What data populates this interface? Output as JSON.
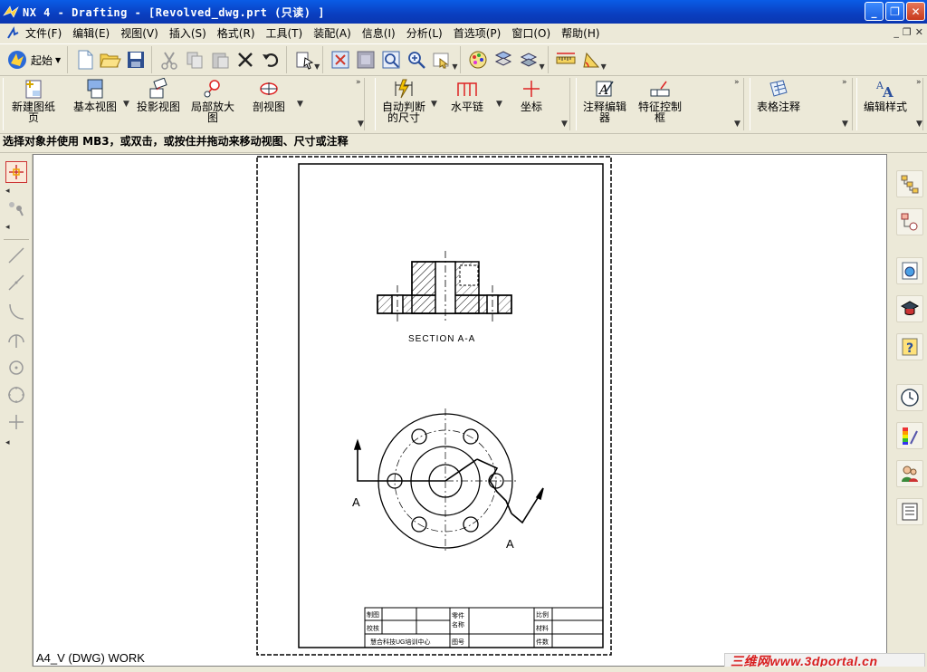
{
  "window": {
    "title": "NX 4 - Drafting - [Revolved_dwg.prt  (只读) ]",
    "minimize": "_",
    "maximize": "❐",
    "close": "✕"
  },
  "menu": {
    "items": [
      "文件(F)",
      "编辑(E)",
      "视图(V)",
      "插入(S)",
      "格式(R)",
      "工具(T)",
      "装配(A)",
      "信息(I)",
      "分析(L)",
      "首选项(P)",
      "窗口(O)",
      "帮助(H)"
    ]
  },
  "toolbar": {
    "start_label": "起始"
  },
  "drafting_toolbar": {
    "new_sheet": "新建图纸页",
    "base_view": "基本视图",
    "projected_view": "投影视图",
    "detail_view": "局部放大图",
    "section_view": "剖视图",
    "auto_dim": "自动判断的尺寸",
    "horizontal_chain": "水平链",
    "coordinate": "坐标",
    "annotation_editor": "注释编辑器",
    "feature_control_frame": "特征控制框",
    "tabular_note": "表格注释",
    "edit_style": "编辑样式"
  },
  "status": {
    "prompt": "选择对象并使用 MB3，或双击，或按住并拖动来移动视图、尺寸或注释"
  },
  "drawing": {
    "section_label": "SECTION  A-A",
    "cut_label_left": "A",
    "cut_label_right": "A",
    "sheet_label": "A4_V (DWG) WORK",
    "title_block": {
      "r1c1": "制图",
      "r2c1": "校核",
      "company": "慧合科技UG培训中心",
      "part_name_1": "零件",
      "part_name_2": "名称",
      "drawing_no": "图号",
      "scale": "比例",
      "material": "材料",
      "quantity": "件数"
    }
  },
  "watermark": {
    "text": "三维网www.3dportal.cn"
  }
}
